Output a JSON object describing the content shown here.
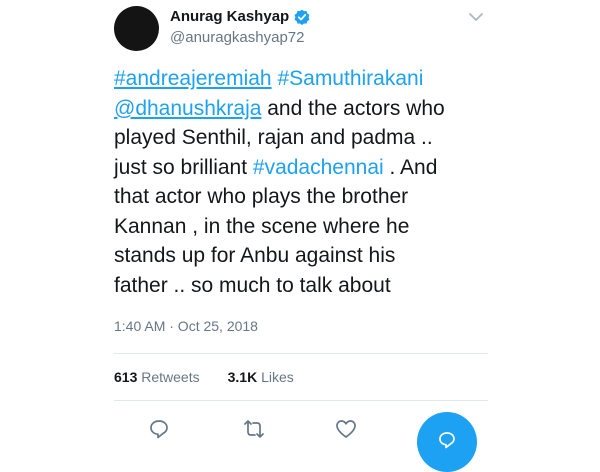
{
  "tweet": {
    "author": {
      "name": "Anurag Kashyap",
      "handle": "@anuragkashyap72"
    },
    "text_lines": [
      [
        {
          "text": "#andreajeremiah",
          "type": "mention"
        },
        {
          "text": " ",
          "type": "plain"
        },
        {
          "text": "#Samuthirakani",
          "type": "link"
        }
      ],
      [
        {
          "text": "@dhanushkraja",
          "type": "mention"
        },
        {
          "text": " and the actors who",
          "type": "plain"
        }
      ],
      [
        {
          "text": "played Senthil, rajan and padma ..",
          "type": "plain"
        }
      ],
      [
        {
          "text": "just so brilliant ",
          "type": "plain"
        },
        {
          "text": "#vadachennai",
          "type": "link"
        },
        {
          "text": " . And",
          "type": "plain"
        }
      ],
      [
        {
          "text": "that actor who plays the brother",
          "type": "plain"
        }
      ],
      [
        {
          "text": "Kannan , in the scene where he",
          "type": "plain"
        }
      ],
      [
        {
          "text": "stands up for Anbu against his",
          "type": "plain"
        }
      ],
      [
        {
          "text": "father .. so much to talk about",
          "type": "plain"
        }
      ]
    ],
    "timestamp": "1:40 AM · Oct 25, 2018",
    "stats": {
      "retweets_count": "613",
      "retweets_label": " Retweets",
      "likes_count": "3.1K",
      "likes_label": " Likes"
    }
  },
  "icons": {
    "verified": "verified-badge-icon",
    "caret": "chevron-down-icon",
    "reply": "reply-icon",
    "retweet": "retweet-icon",
    "like": "heart-icon",
    "compose": "compose-icon"
  },
  "colors": {
    "accent": "#1da1f2",
    "text": "#14171a",
    "muted": "#657786",
    "divider": "#e1e8ed"
  }
}
